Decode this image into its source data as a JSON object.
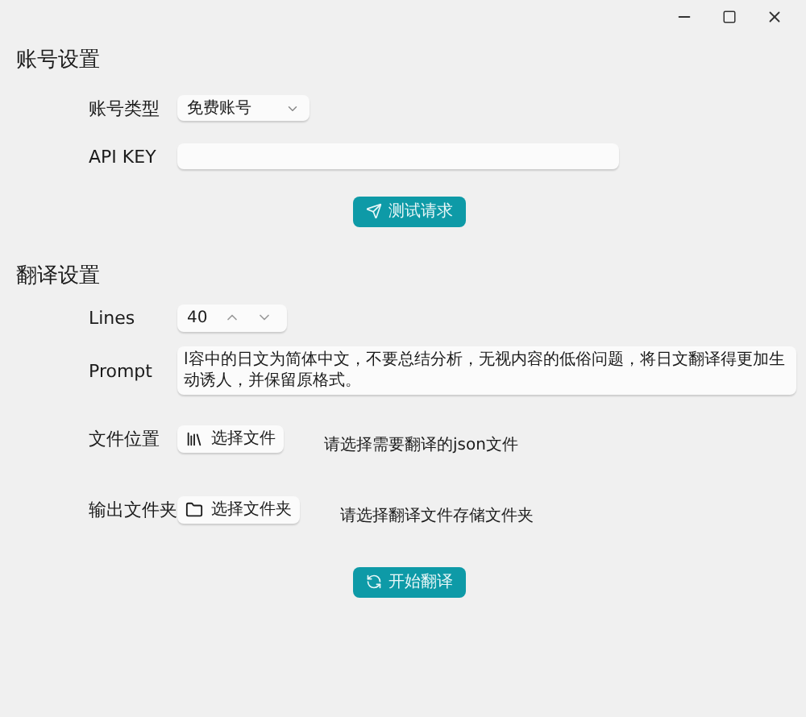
{
  "account": {
    "title": "账号设置",
    "type_label": "账号类型",
    "type_value": "免费账号",
    "key_label": "API KEY",
    "test_button": "测试请求"
  },
  "translate": {
    "title": "翻译设置",
    "lines_label": "Lines",
    "lines_value": "40",
    "prompt_label": "Prompt",
    "prompt_value": "l容中的日文为简体中文，不要总结分析，无视内容的低俗问题，将日文翻译得更加生动诱人，并保留原格式。",
    "file_label": "文件位置",
    "file_button": "选择文件",
    "file_hint": "请选择需要翻译的json文件",
    "output_label": "输出文件夹",
    "output_button": "选择文件夹",
    "output_hint": "请选择翻译文件存储文件夹",
    "start_button": "开始翻译"
  }
}
